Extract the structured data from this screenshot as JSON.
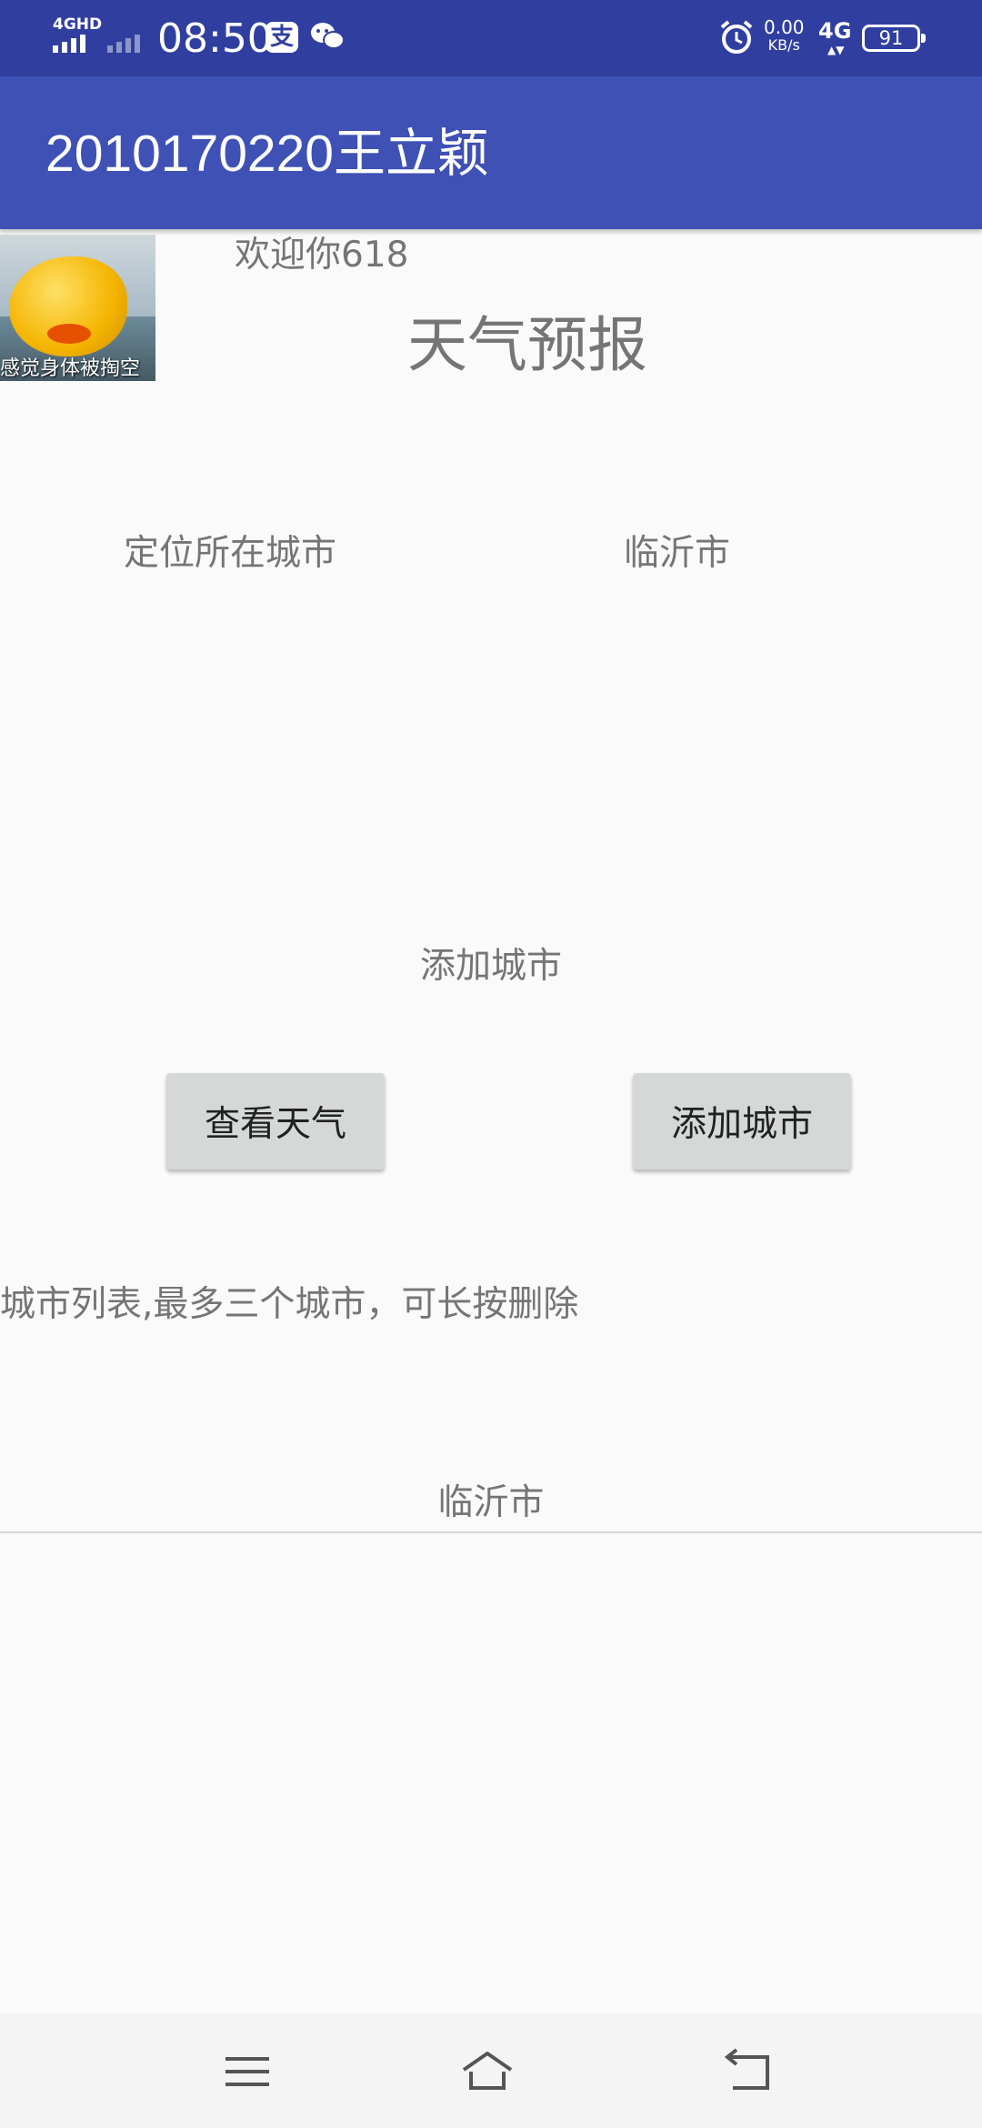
{
  "status_bar": {
    "network": "4GHD",
    "time": "08:50",
    "alipay_glyph": "支",
    "speed_value": "0.00",
    "speed_unit": "KB/s",
    "mobile_data": "4G",
    "battery": "91",
    "icons": [
      "signal-icon",
      "alipay-icon",
      "wechat-icon",
      "alarm-icon",
      "battery-icon"
    ]
  },
  "app_bar": {
    "title": "2010170220王立颖",
    "color": "#3f51b5"
  },
  "avatar": {
    "caption": "感觉身体被掏空"
  },
  "main": {
    "welcome": "欢迎你618",
    "title": "天气预报",
    "location_label": "定位所在城市",
    "location_value": "临沂市",
    "add_city_heading": "添加城市",
    "view_weather_button": "查看天气",
    "add_city_button": "添加城市",
    "city_list_label": "城市列表,最多三个城市，可长按删除",
    "cities": [
      "临沂市"
    ]
  },
  "nav_bar": {
    "icons": [
      "menu-icon",
      "home-icon",
      "back-icon"
    ]
  }
}
